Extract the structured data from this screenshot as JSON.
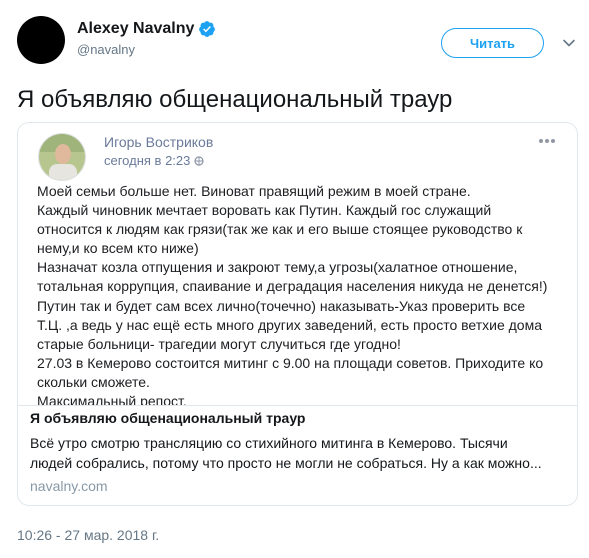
{
  "author": {
    "display_name": "Alexey Navalny",
    "handle": "@navalny",
    "verified": true
  },
  "follow_button_label": "Читать",
  "tweet": {
    "text": "Я объявляю общенациональный траур",
    "timestamp": "10:26 - 27 мар. 2018 г."
  },
  "embedded_post": {
    "author": "Игорь Востриков",
    "time": "сегодня в 2:23",
    "lines": [
      "Моей семьи больше нет. Виноват правящий режим в моей стране.",
      "Каждый чиновник мечтает воровать как Путин. Каждый гос служащий",
      "относится к людям как грязи(так же как и его выше стоящее руководство к",
      "нему,и ко всем кто ниже)",
      "Назначат козла отпущения и закроют тему,а угрозы(халатное отношение,",
      "тотальная коррупция, спаивание и деградация населения никуда не денется!)",
      "Путин так и будет сам всех лично(точечно) наказывать-Указ проверить все",
      "Т.Ц. ,а ведь у нас ещё есть много других заведений, есть просто ветхие дома",
      "старые больници- трагедии могут случиться где угодно!",
      "27.03 в Кемерово состоится митинг с 9.00 на площади советов. Приходите ко",
      "скольки сможете.",
      "Максимальный репост."
    ]
  },
  "link_card": {
    "title": "Я объявляю общенациональный траур",
    "description_lines": [
      "Всё утро смотрю трансляцию со стихийного митинга в Кемерово. Тысячи",
      "людей собрались, потому что просто не могли не собраться. Ну а как можно..."
    ],
    "domain": "navalny.com"
  },
  "colors": {
    "accent": "#1da1f2",
    "text": "#14171a",
    "muted": "#657786",
    "fb_meta": "#6a7a9a",
    "border": "#e1e8ed"
  },
  "icons": [
    "verified-badge-icon",
    "chevron-down-icon",
    "globe-icon",
    "more-options-icon"
  ]
}
